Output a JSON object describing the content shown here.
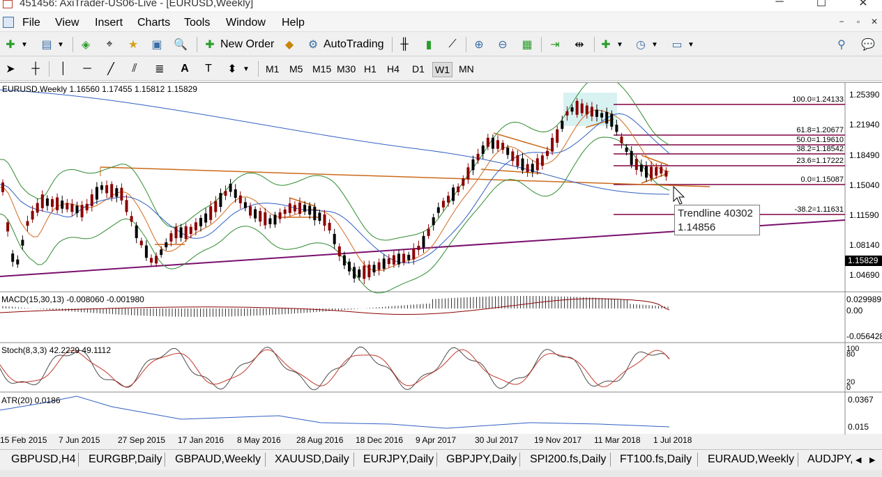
{
  "window": {
    "title": "451456: AxiTrader-US06-Live - [EURUSD,Weekly]"
  },
  "menu": [
    "File",
    "View",
    "Insert",
    "Charts",
    "Tools",
    "Window",
    "Help"
  ],
  "toolbar1": {
    "new_order": "New Order",
    "autotrading": "AutoTrading"
  },
  "timeframes": [
    "M1",
    "M5",
    "M15",
    "M30",
    "H1",
    "H4",
    "D1",
    "W1",
    "MN"
  ],
  "active_timeframe": "W1",
  "chart": {
    "header": "EURUSD,Weekly  1.16560 1.17455 1.15812 1.15829",
    "price_axis": [
      "1.25390",
      "1.21940",
      "1.18490",
      "1.15040",
      "1.11590",
      "1.08140",
      "1.04690"
    ],
    "current_price": "1.15829",
    "fib_levels": [
      "100.0=1.24133",
      "61.8=1.20677",
      "50.0=1.19610",
      "38.2=1.18542",
      "23.6=1.17222",
      "0.0=1.15087",
      "-38.2=1.11631"
    ],
    "tooltip": {
      "name": "Trendline 40302",
      "value": "1.14856"
    },
    "macd": {
      "label": "MACD(15,30,13) -0.008060 -0.001980",
      "axis": [
        "0.029989",
        "0.00",
        "-0.056428"
      ]
    },
    "stoch": {
      "label": "Stoch(8,3,3) 42.2229 49.1112",
      "axis": [
        "100",
        "80",
        "20",
        "0"
      ]
    },
    "atr": {
      "label": "ATR(20) 0.0186",
      "axis": [
        "0.0367",
        "0.015"
      ]
    },
    "dates": [
      "15 Feb 2015",
      "7 Jun 2015",
      "27 Sep 2015",
      "17 Jan 2016",
      "8 May 2016",
      "28 Aug 2016",
      "18 Dec 2016",
      "9 Apr 2017",
      "30 Jul 2017",
      "19 Nov 2017",
      "11 Mar 2018",
      "1 Jul 2018"
    ]
  },
  "tabs": [
    "GBPUSD,H4",
    "EURGBP,Daily",
    "GBPAUD,Weekly",
    "XAUUSD,Daily",
    "EURJPY,Daily",
    "GBPJPY,Daily",
    "SPI200.fs,Daily",
    "FT100.fs,Daily",
    "EURAUD,Weekly",
    "AUDJPY,D"
  ],
  "colors": {
    "bull": "#000000",
    "bear": "#8b0000",
    "fib": "#800040",
    "ma_blue": "#2f5fc4",
    "ma_orange": "#d2691e",
    "bollinger": "#2e8b2e"
  }
}
